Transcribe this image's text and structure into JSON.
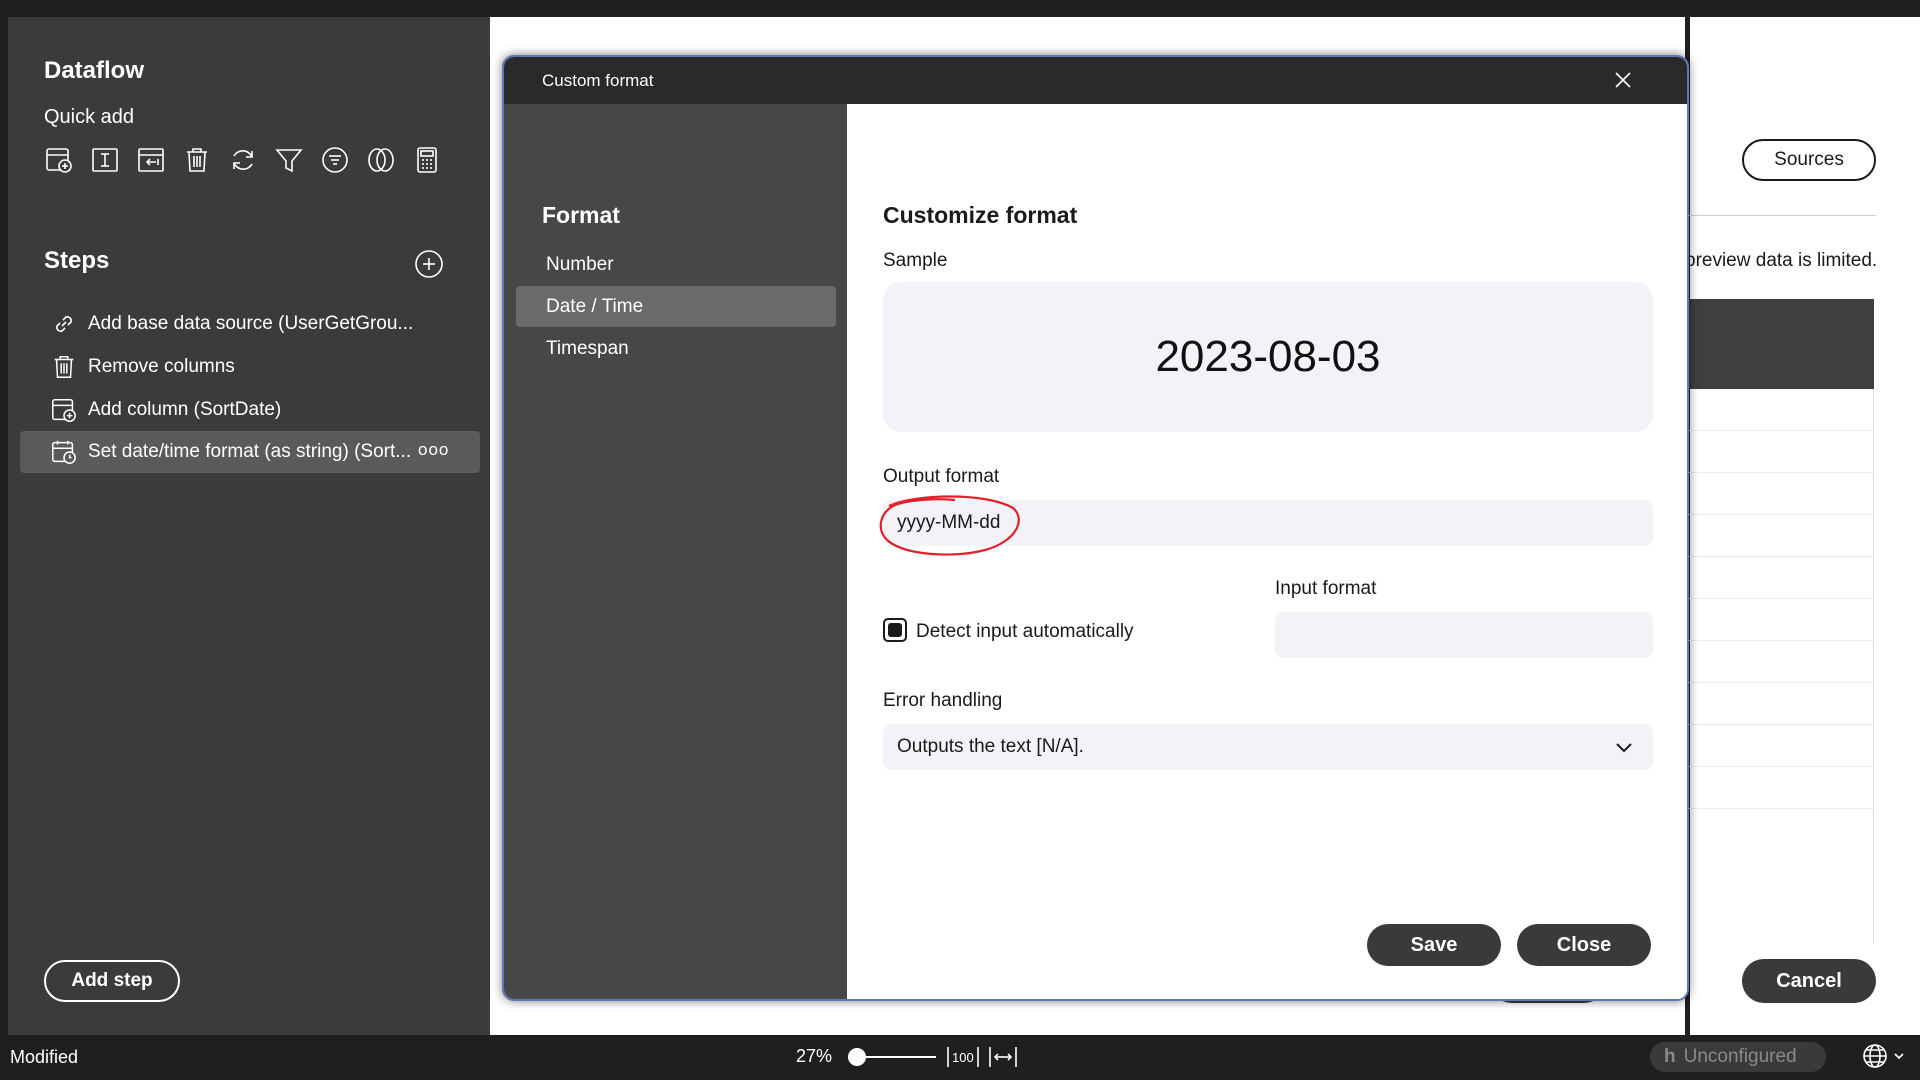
{
  "sidebar": {
    "title": "Dataflow",
    "quick_add_label": "Quick add",
    "quick_add_icons": [
      "add-table-icon",
      "text-cursor-icon",
      "import-icon",
      "trash-icon",
      "refresh-icon",
      "filter-icon",
      "filter-list-icon",
      "venn-icon",
      "calculator-icon"
    ],
    "steps_title": "Steps",
    "steps": [
      {
        "label": "Add base data source (UserGetGrou...",
        "icon": "link-icon"
      },
      {
        "label": "Remove columns",
        "icon": "trash-icon"
      },
      {
        "label": "Add column (SortDate)",
        "icon": "add-table-icon"
      },
      {
        "label": "Set date/time format (as string) (Sort...",
        "icon": "calendar-clock-icon",
        "selected": true,
        "more": "ooo"
      }
    ],
    "add_step_label": "Add step"
  },
  "background": {
    "sources_label": "Sources",
    "preview_note": "preview data is limited.",
    "cancel_label": "Cancel"
  },
  "dialog": {
    "title": "Custom format",
    "nav_title": "Format",
    "nav_items": [
      {
        "label": "Number"
      },
      {
        "label": "Date / Time",
        "selected": true
      },
      {
        "label": "Timespan"
      }
    ],
    "heading": "Customize format",
    "sample_label": "Sample",
    "sample_value": "2023-08-03",
    "output_format_label": "Output format",
    "output_format_value": "yyyy-MM-dd",
    "input_format_label": "Input format",
    "input_format_value": "",
    "detect_label": "Detect input automatically",
    "detect_checked": true,
    "error_handling_label": "Error handling",
    "error_handling_value": "Outputs the text [N/A].",
    "save_label": "Save",
    "close_label": "Close",
    "annotation_color": "#e0202a"
  },
  "statusbar": {
    "status": "Modified",
    "zoom": "27%",
    "zoom_fraction": 0.05,
    "fit_100_label": "100",
    "unconfigured_label": "Unconfigured"
  }
}
